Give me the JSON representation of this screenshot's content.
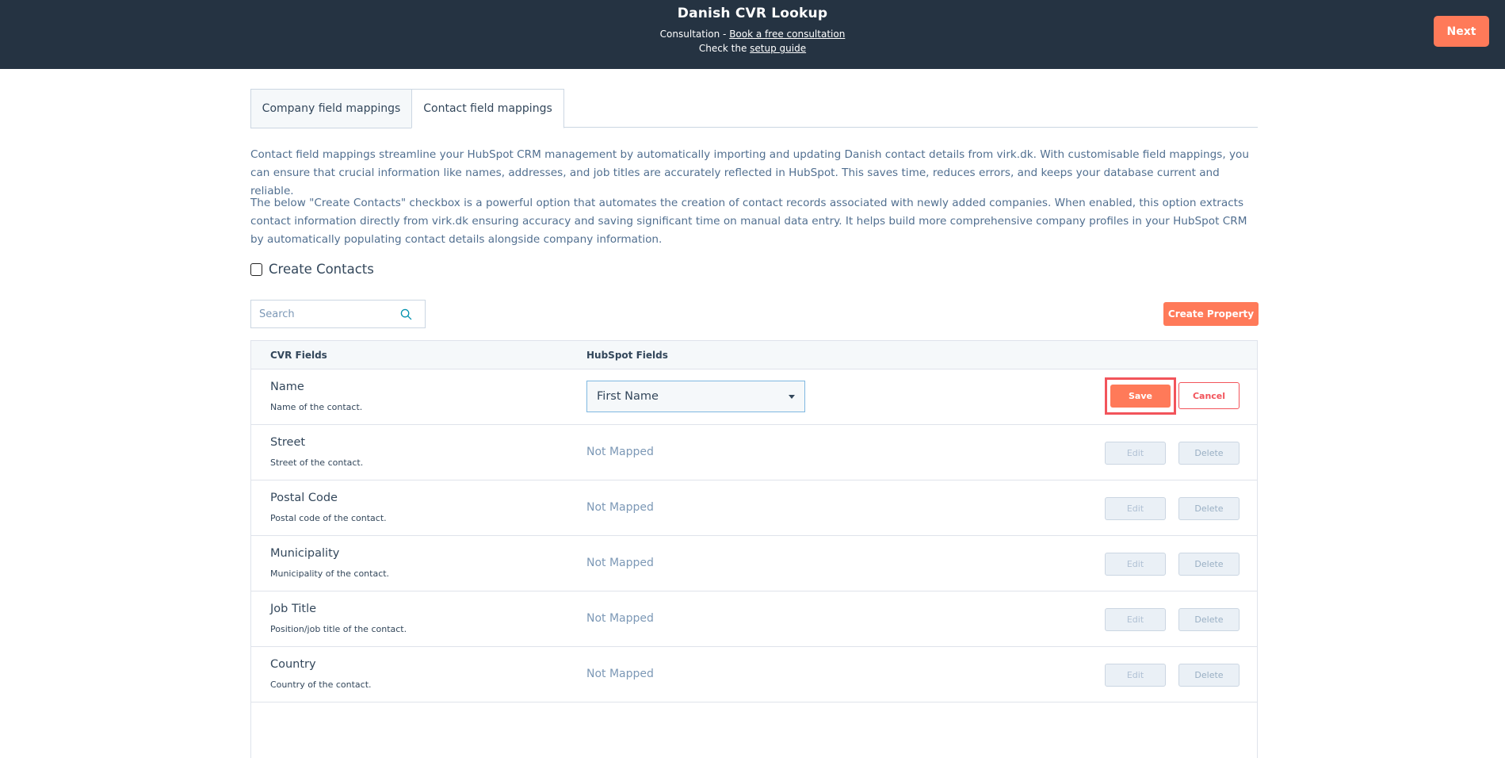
{
  "header": {
    "title": "Danish CVR Lookup",
    "consultation_prefix": "Consultation - ",
    "consultation_link": "Book a free consultation",
    "guide_prefix": "Check the ",
    "guide_link": "setup guide",
    "next_label": "Next"
  },
  "tabs": [
    {
      "label": "Company field mappings",
      "active": false
    },
    {
      "label": "Contact field mappings",
      "active": true
    }
  ],
  "description": {
    "p1": "Contact field mappings streamline your HubSpot CRM management by automatically importing and updating Danish contact details from virk.dk. With customisable field mappings, you can ensure that crucial information like names, addresses, and job titles are accurately reflected in HubSpot. This saves time, reduces errors, and keeps your database current and reliable.",
    "p2": "The below \"Create Contacts\" checkbox is a powerful option that automates the creation of contact records associated with newly added companies. When enabled, this option extracts contact information directly from virk.dk ensuring accuracy and saving significant time on manual data entry. It helps build more comprehensive company profiles in your HubSpot CRM by automatically populating contact details alongside company information."
  },
  "create_contacts": {
    "label": "Create Contacts",
    "checked": false
  },
  "search": {
    "placeholder": "Search",
    "value": "",
    "icon": "search-icon"
  },
  "create_property_label": "Create Property",
  "table": {
    "columns": [
      "CVR Fields",
      "HubSpot Fields"
    ],
    "rows": [
      {
        "name": "Name",
        "description": "Name of the contact.",
        "mapping": "First Name",
        "editing": true
      },
      {
        "name": "Street",
        "description": "Street of the contact.",
        "mapping": "Not Mapped",
        "editing": false
      },
      {
        "name": "Postal Code",
        "description": "Postal code of the contact.",
        "mapping": "Not Mapped",
        "editing": false
      },
      {
        "name": "Municipality",
        "description": "Municipality of the contact.",
        "mapping": "Not Mapped",
        "editing": false
      },
      {
        "name": "Job Title",
        "description": "Position/job title of the contact.",
        "mapping": "Not Mapped",
        "editing": false
      },
      {
        "name": "Country",
        "description": "Country of the contact.",
        "mapping": "Not Mapped",
        "editing": false
      }
    ],
    "save_label": "Save",
    "cancel_label": "Cancel",
    "edit_label": "Edit",
    "delete_label": "Delete"
  },
  "colors": {
    "header_bg": "#253342",
    "accent": "#ff7a59",
    "danger": "#f2545b",
    "muted_text": "#7c98b6"
  }
}
